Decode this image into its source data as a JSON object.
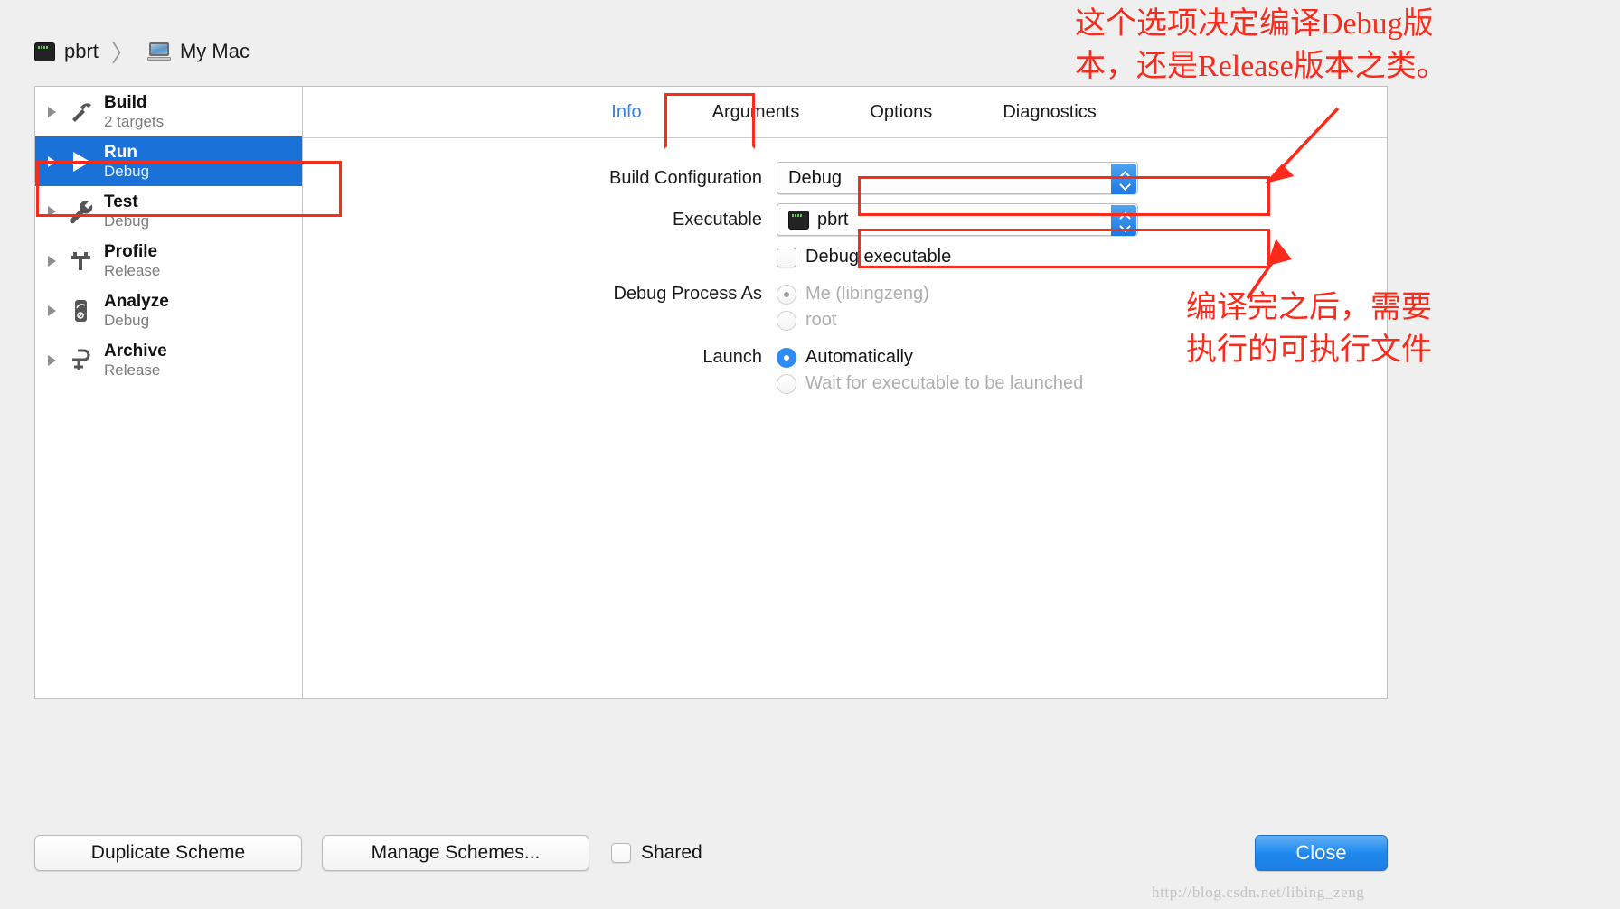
{
  "window": {
    "breadcrumb": {
      "project": "pbrt",
      "project_icon": "terminal-icon",
      "separator": "〉",
      "destination": "My Mac",
      "destination_icon": "macbook-icon"
    }
  },
  "sidebar": {
    "items": [
      {
        "title": "Build",
        "subtitle": "2 targets",
        "icon": "hammer-icon",
        "selected": false
      },
      {
        "title": "Run",
        "subtitle": "Debug",
        "icon": "play-icon",
        "selected": true
      },
      {
        "title": "Test",
        "subtitle": "Debug",
        "icon": "wrench-icon",
        "selected": false
      },
      {
        "title": "Profile",
        "subtitle": "Release",
        "icon": "caliper-icon",
        "selected": false
      },
      {
        "title": "Analyze",
        "subtitle": "Debug",
        "icon": "analyze-icon",
        "selected": false
      },
      {
        "title": "Archive",
        "subtitle": "Release",
        "icon": "clamp-icon",
        "selected": false
      }
    ]
  },
  "tabs": [
    {
      "label": "Info",
      "active": true
    },
    {
      "label": "Arguments",
      "active": false
    },
    {
      "label": "Options",
      "active": false
    },
    {
      "label": "Diagnostics",
      "active": false
    }
  ],
  "info_pane": {
    "build_configuration": {
      "label": "Build Configuration",
      "value": "Debug"
    },
    "executable": {
      "label": "Executable",
      "value": "pbrt",
      "icon": "terminal-icon"
    },
    "debug_executable": {
      "label": "Debug executable",
      "checked": false
    },
    "debug_process_as": {
      "label": "Debug Process As",
      "options": [
        {
          "label": "Me (libingzeng)",
          "selected": true,
          "disabled": true
        },
        {
          "label": "root",
          "selected": false,
          "disabled": true
        }
      ]
    },
    "launch": {
      "label": "Launch",
      "options": [
        {
          "label": "Automatically",
          "selected": true,
          "disabled": false
        },
        {
          "label": "Wait for executable to be launched",
          "selected": false,
          "disabled": true
        }
      ]
    }
  },
  "footer": {
    "duplicate_scheme": "Duplicate Scheme",
    "manage_schemes": "Manage Schemes...",
    "shared_label": "Shared",
    "shared_checked": false,
    "close": "Close"
  },
  "annotations": {
    "color": "#fb2b1c",
    "top_note": "这个选项决定编译Debug版\n本，还是Release版本之类。",
    "mid_note": "编译完之后，需要\n执行的可执行文件"
  },
  "watermark": "http://blog.csdn.net/libing_zeng"
}
